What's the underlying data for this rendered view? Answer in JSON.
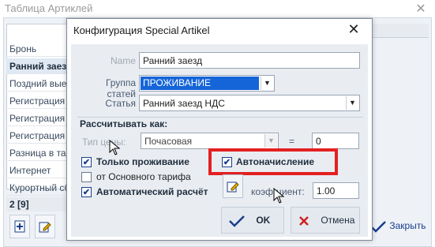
{
  "background_window": {
    "title": "Таблица Артиклей",
    "close_glyph": "✕",
    "rows": [
      "Бронь",
      "Ранний заезд",
      "Поздний выезд",
      "Регистрация РФ",
      "Регистрация СНГ",
      "Регистрация Ин",
      "Разница в тарифе",
      "Интернет",
      "Курортный сбор"
    ],
    "selected_row": 1,
    "status": "2 [9]",
    "close_button": "Закрыть",
    "tool_icons": [
      "add-icon",
      "edit-icon"
    ]
  },
  "dialog": {
    "title": "Конфигурация Special Artikel",
    "close_glyph": "✕",
    "name_label": "Name",
    "name_value": "Ранний заезд",
    "group_label": "Группа статей",
    "group_value": "ПРОЖИВАНИЕ",
    "article_label": "Статья",
    "article_value": "Ранний заезд НДС",
    "calc_group_label": "Рассчитывать как:",
    "price_type_label": "Тип цены:",
    "price_type_value": "Почасовая",
    "equals": "=",
    "equals_value": "0",
    "only_accommodation": "Только проживание",
    "from_base_tariff": "от Основного тарифа",
    "auto_calc": "Автоматический расчёт",
    "auto_charge": "Автоначисление",
    "coef_label": "коэф-циент:",
    "coef_value": "1.00",
    "ok_label": "OK",
    "cancel_label": "Отмена",
    "highlight_color": "#e32021",
    "accent_color": "#1565d8"
  }
}
